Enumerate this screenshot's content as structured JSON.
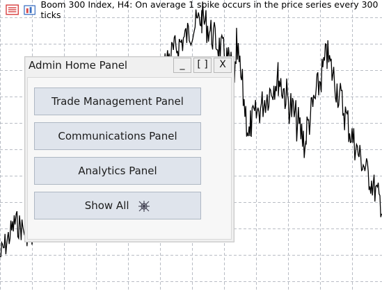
{
  "header": {
    "title": "Boom 300 Index, H4:  On average 1 spike occurs in the price series every 300 ticks"
  },
  "panel": {
    "title": "Admin Home Panel",
    "minimize_label": "_",
    "maximize_label": "[ ]",
    "close_label": "X",
    "buttons": [
      {
        "label": "Trade Management Panel"
      },
      {
        "label": "Communications Panel"
      },
      {
        "label": "Analytics Panel"
      },
      {
        "label": "Show All"
      }
    ]
  },
  "colors": {
    "grid": "#b8bcc4",
    "price_line": "#000000",
    "button_bg": "#dfe4ec"
  }
}
